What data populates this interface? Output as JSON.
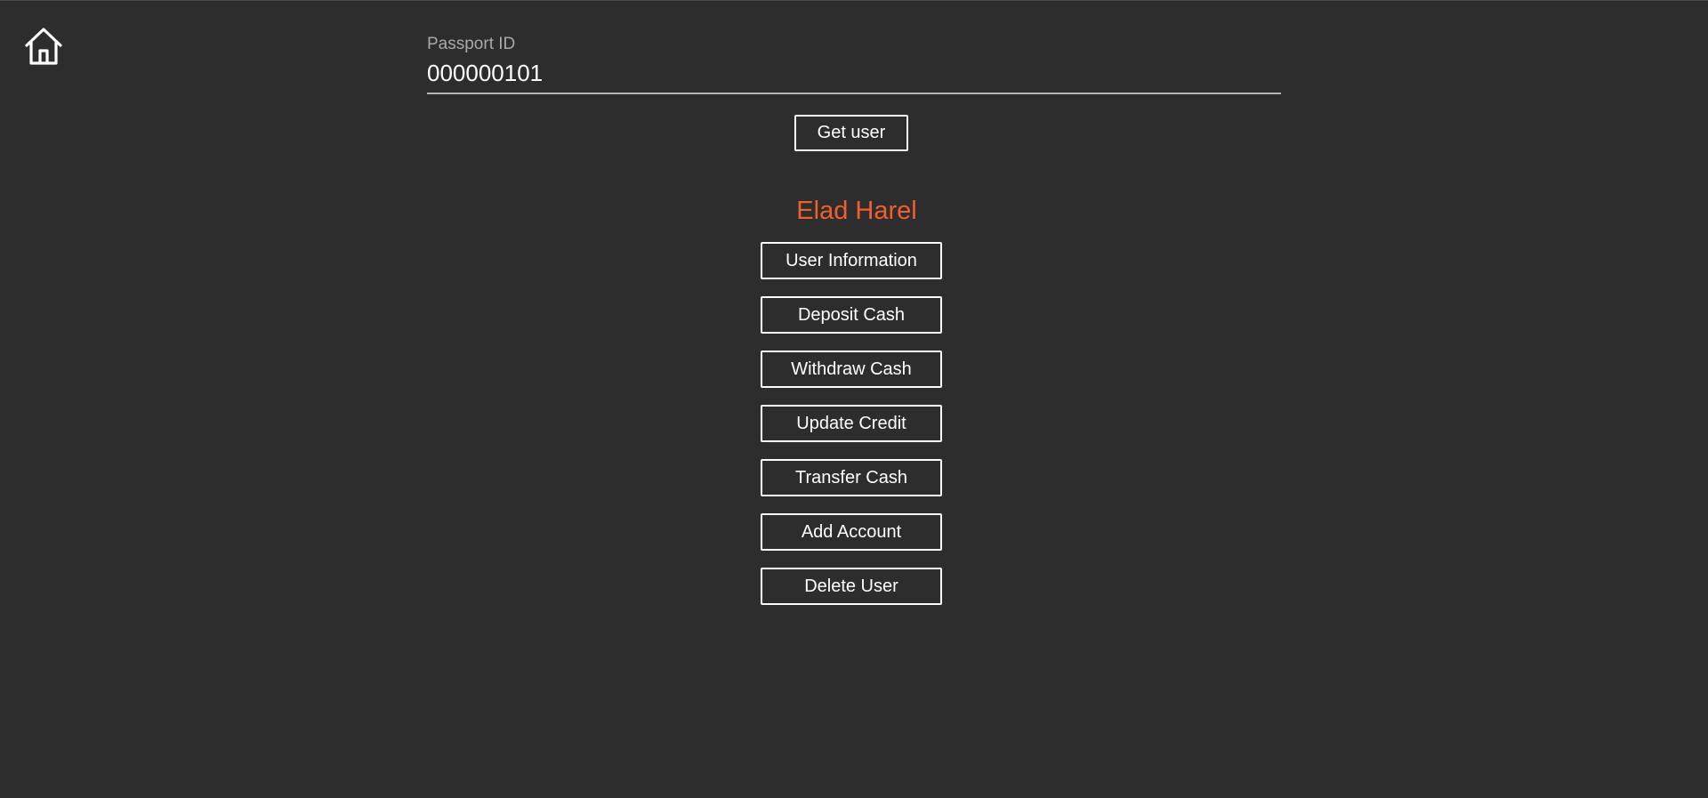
{
  "nav": {
    "home_icon": "home-icon"
  },
  "search": {
    "label": "Passport ID",
    "value": "000000101",
    "button_label": "Get user"
  },
  "user": {
    "name": "Elad Harel",
    "name_color": "#f0602e"
  },
  "actions": [
    "User Information",
    "Deposit Cash",
    "Withdraw Cash",
    "Update Credit",
    "Transfer Cash",
    "Add Account",
    "Delete User"
  ],
  "colors": {
    "background": "#2d2d2d",
    "accent": "#f0602e",
    "foreground": "#ffffff",
    "label": "#a9a9a9"
  }
}
